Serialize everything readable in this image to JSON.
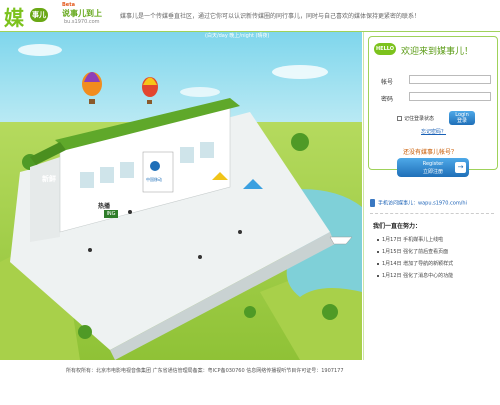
{
  "header": {
    "logo_mark": "媒",
    "logo_badge": "事儿",
    "logo_beta": "Beta",
    "logo_cn": "说事儿到上",
    "logo_url": "bu.s1970.com",
    "slogan": "媒事儿是一个传媒垂直社区，通过它你可以认识新传媒圈的同行事儿，同时与自己喜欢的媒体保持更紧密的联系！"
  },
  "scene": {
    "caption": "(白天/day 晚上/night (晴夜)",
    "shop_left": "新鲜",
    "shop_right": "快乐",
    "building_sign": "媒事儿",
    "building_sign_sub": "传媒人集上",
    "mobile_brand": "中国移动",
    "ad_hot": "热播",
    "ad_ing": "ING"
  },
  "login": {
    "hello": "HELLO",
    "welcome": "欢迎来到媒事儿！",
    "account_label": "帐号",
    "password_label": "密码",
    "account_value": "",
    "password_value": "",
    "remember_label": "记住登录状态",
    "login_btn_line1": "Login",
    "login_btn_line2": "登录",
    "forgot": "忘记密码？",
    "no_account": "还没有媒事儿帐号？",
    "register_line1": "Register",
    "register_line2": "立即注册",
    "mobile_text": "手机访问媒事儿：wapu.s1970.com/hi"
  },
  "news": {
    "title": "我们一直在努力：",
    "items": [
      "1月17日  手机媒事儿上线啦",
      "1月15日  强化了前后查看页面",
      "1月14日  增加了导航的新颖样式",
      "1月12日  强化了消息中心的功能"
    ]
  },
  "footer": {
    "text": "所有权所有：北京市电影电视音像集团 广东省通信管理局备案：粤ICP备030760 信息网络传播视听节目许可证号：1907177"
  },
  "colors": {
    "brand_green": "#7cc21d",
    "link_blue": "#1a61b6",
    "accent_orange": "#c85a00",
    "grass": "#9ccb3c",
    "water": "#7fd0d8"
  }
}
